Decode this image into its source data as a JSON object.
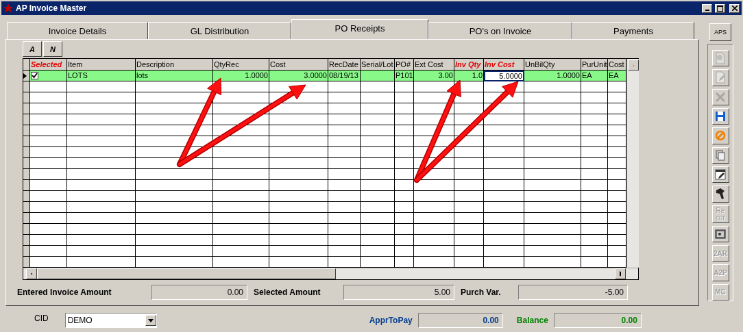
{
  "window": {
    "title": "AP Invoice Master"
  },
  "tabs": [
    {
      "label": "Invoice Details",
      "selected": false
    },
    {
      "label": "GL Distribution",
      "selected": false
    },
    {
      "label": "PO Receipts",
      "selected": true
    },
    {
      "label": "PO's on Invoice",
      "selected": false
    },
    {
      "label": "Payments",
      "selected": false
    }
  ],
  "filter_buttons": [
    "A",
    "N"
  ],
  "table": {
    "columns": [
      {
        "label": "Selected",
        "emphasis": true
      },
      {
        "label": "Item",
        "emphasis": false
      },
      {
        "label": "Description",
        "emphasis": false
      },
      {
        "label": "QtyRec",
        "emphasis": false
      },
      {
        "label": "Cost",
        "emphasis": false
      },
      {
        "label": "RecDate",
        "emphasis": false
      },
      {
        "label": "Serial/Lot",
        "emphasis": false
      },
      {
        "label": "PO#",
        "emphasis": false
      },
      {
        "label": "Ext Cost",
        "emphasis": false
      },
      {
        "label": "Inv Qty",
        "emphasis": true
      },
      {
        "label": "Inv Cost",
        "emphasis": true
      },
      {
        "label": "UnBilQty",
        "emphasis": false
      },
      {
        "label": "PurUnit",
        "emphasis": false
      },
      {
        "label": "Cost",
        "emphasis": false
      }
    ],
    "rows": [
      {
        "current": true,
        "cells": [
          {
            "kind": "checkbox",
            "checked": true
          },
          {
            "text": "LOTS",
            "focused": false
          },
          {
            "text": "lots",
            "focused": false
          },
          {
            "text": "1.0000",
            "focused": false
          },
          {
            "text": "3.0000",
            "focused": false
          },
          {
            "text": "08/19/13",
            "focused": false
          },
          {
            "kind": "blank"
          },
          {
            "text": "P101",
            "focused": false
          },
          {
            "text": "3.00",
            "focused": false
          },
          {
            "text": "1.0",
            "focused": false
          },
          {
            "text": "5.0000",
            "focused": true
          },
          {
            "text": "1.0000",
            "focused": false
          },
          {
            "text": "EA",
            "focused": false
          },
          {
            "text": "EA",
            "focused": false
          }
        ]
      }
    ]
  },
  "totals": [
    {
      "label": "Entered Invoice Amount",
      "value": "0.00"
    },
    {
      "label": "Selected Amount",
      "value": "5.00"
    },
    {
      "label": "Purch Var.",
      "value": "-5.00"
    }
  ],
  "aps_button": "APS",
  "toolbar": [
    {
      "kind": "document",
      "disabled": true
    },
    {
      "kind": "edit",
      "disabled": true
    },
    {
      "kind": "delete",
      "disabled": true
    },
    {
      "kind": "save",
      "disabled": false
    },
    {
      "kind": "cancel",
      "disabled": false
    },
    {
      "kind": "copy",
      "disabled": false
    },
    {
      "kind": "note",
      "disabled": false
    },
    {
      "kind": "tool",
      "disabled": false
    },
    {
      "kind": "text",
      "label": "Re cur",
      "disabled": true
    },
    {
      "kind": "safe",
      "disabled": false
    },
    {
      "kind": "text",
      "label": "2AR",
      "disabled": true
    },
    {
      "kind": "text",
      "label": "A2P",
      "disabled": true
    },
    {
      "kind": "text",
      "label": "MC",
      "disabled": true
    }
  ],
  "cid": {
    "label": "CID",
    "value": "DEMO"
  },
  "summary": [
    {
      "label": "ApprToPay",
      "value": "0.00",
      "color": "#003c8c"
    },
    {
      "label": "Balance",
      "value": "0.00",
      "color": "#008000"
    }
  ]
}
